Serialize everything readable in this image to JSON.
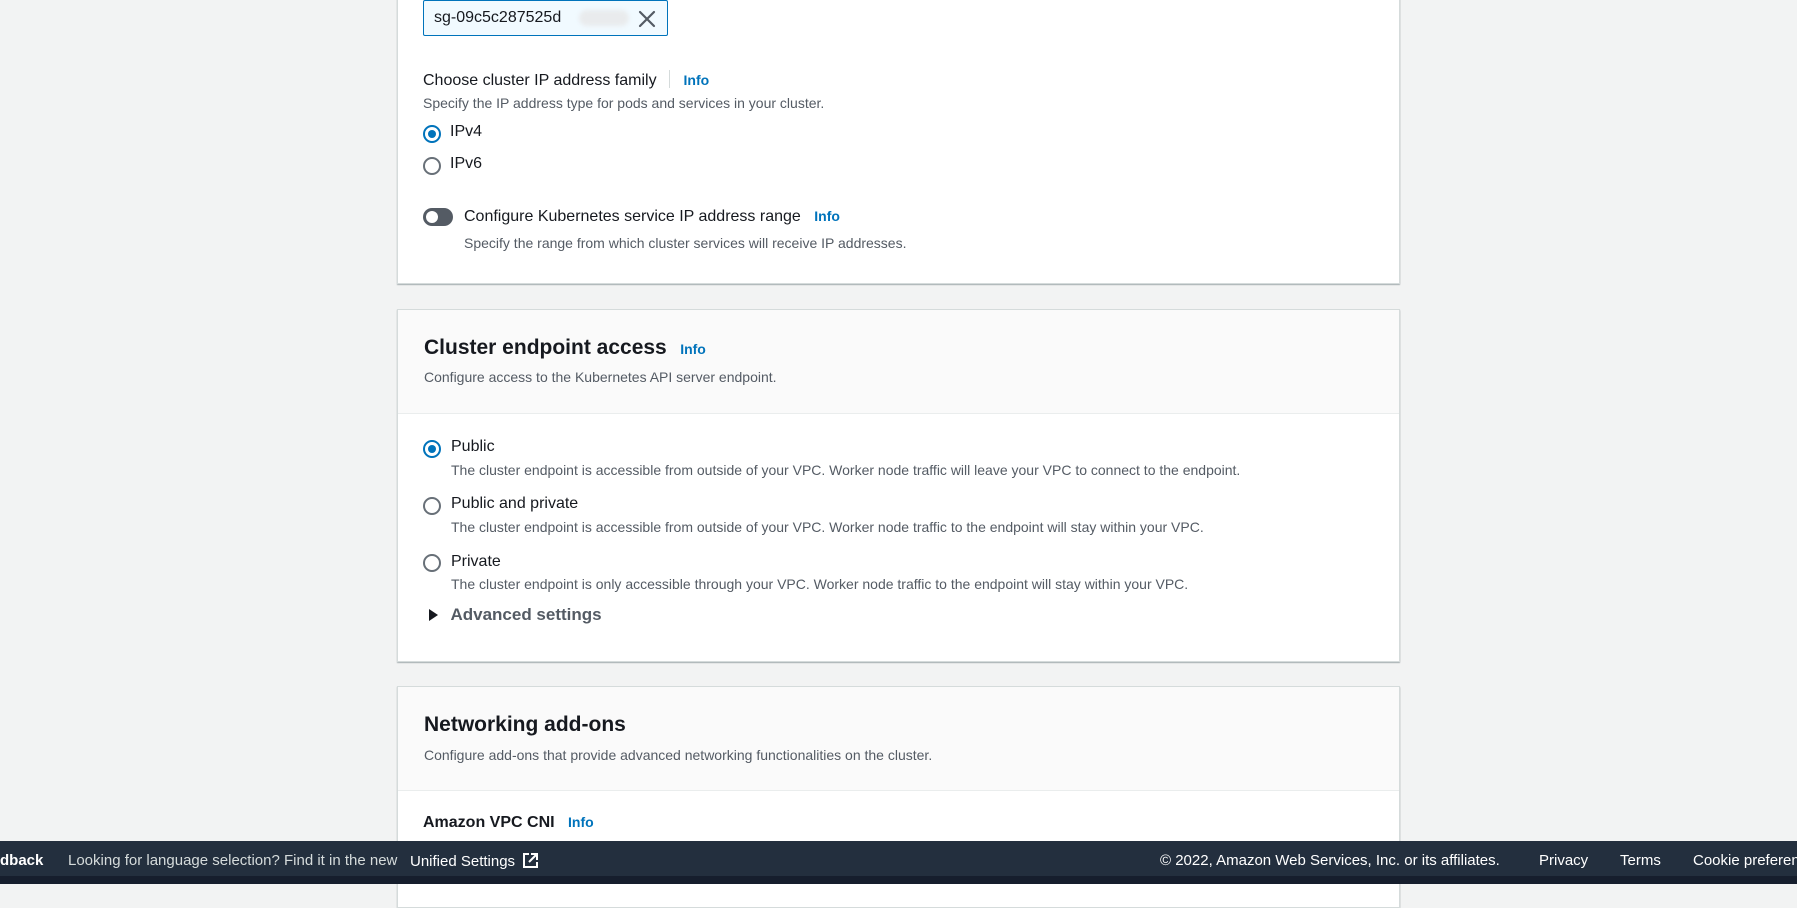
{
  "security_group": {
    "token_value": "sg-09c5c287525d",
    "clear_icon": "close-icon"
  },
  "ip_family": {
    "label": "Choose cluster IP address family",
    "info": "Info",
    "description": "Specify the IP address type for pods and services in your cluster.",
    "options": [
      {
        "label": "IPv4",
        "selected": true
      },
      {
        "label": "IPv6",
        "selected": false
      }
    ]
  },
  "service_range": {
    "label": "Configure Kubernetes service IP address range",
    "info": "Info",
    "description": "Specify the range from which cluster services will receive IP addresses.",
    "enabled": false
  },
  "endpoint_access": {
    "title": "Cluster endpoint access",
    "info": "Info",
    "description": "Configure access to the Kubernetes API server endpoint.",
    "options": [
      {
        "label": "Public",
        "selected": true,
        "description": "The cluster endpoint is accessible from outside of your VPC. Worker node traffic will leave your VPC to connect to the endpoint."
      },
      {
        "label": "Public and private",
        "selected": false,
        "description": "The cluster endpoint is accessible from outside of your VPC. Worker node traffic to the endpoint will stay within your VPC."
      },
      {
        "label": "Private",
        "selected": false,
        "description": "The cluster endpoint is only accessible through your VPC. Worker node traffic to the endpoint will stay within your VPC."
      }
    ],
    "advanced_settings": "Advanced settings"
  },
  "networking_addons": {
    "title": "Networking add-ons",
    "description": "Configure add-ons that provide advanced networking functionalities on the cluster.",
    "vpc_cni_label": "Amazon VPC CNI",
    "vpc_cni_info": "Info"
  },
  "footer": {
    "feedback": "dback",
    "language_text": "Looking for language selection? Find it in the new",
    "unified_settings": "Unified Settings",
    "copyright": "© 2022, Amazon Web Services, Inc. or its affiliates.",
    "privacy": "Privacy",
    "terms": "Terms",
    "cookie": "Cookie preferen"
  },
  "colors": {
    "link": "#0073bb",
    "footer_bg": "#232f3e",
    "page_bg": "#f2f3f3"
  }
}
